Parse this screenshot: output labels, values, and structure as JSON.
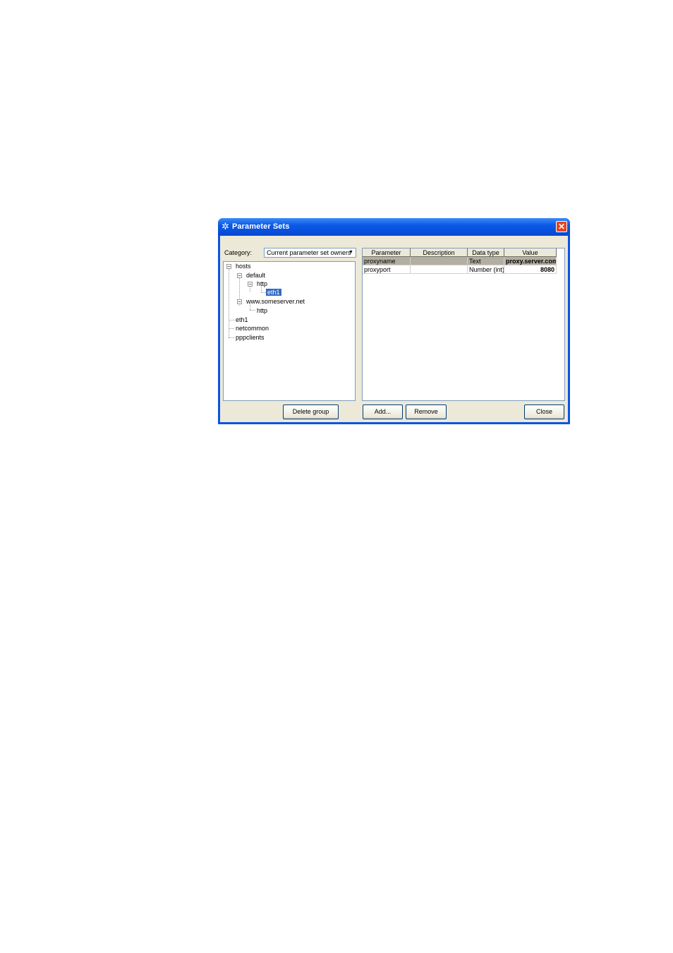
{
  "window": {
    "title": "Parameter Sets"
  },
  "category": {
    "label": "Category:",
    "value": "Current parameter set owners"
  },
  "tree": {
    "nodes": [
      "hosts",
      "default",
      "http",
      "eth1",
      "www.someserver.net",
      "http",
      "eth1",
      "netcommon",
      "pppclients"
    ],
    "selected": "eth1"
  },
  "grid": {
    "columns": [
      "Parameter",
      "Description",
      "Data type",
      "Value"
    ],
    "rows": [
      {
        "parameter": "proxyname",
        "description": "",
        "data_type": "Text",
        "value": "proxy.server.com"
      },
      {
        "parameter": "proxyport",
        "description": "",
        "data_type": "Number (int)",
        "value": "8080"
      }
    ]
  },
  "buttons": {
    "delete_group": "Delete group",
    "add": "Add...",
    "remove": "Remove",
    "close": "Close"
  }
}
